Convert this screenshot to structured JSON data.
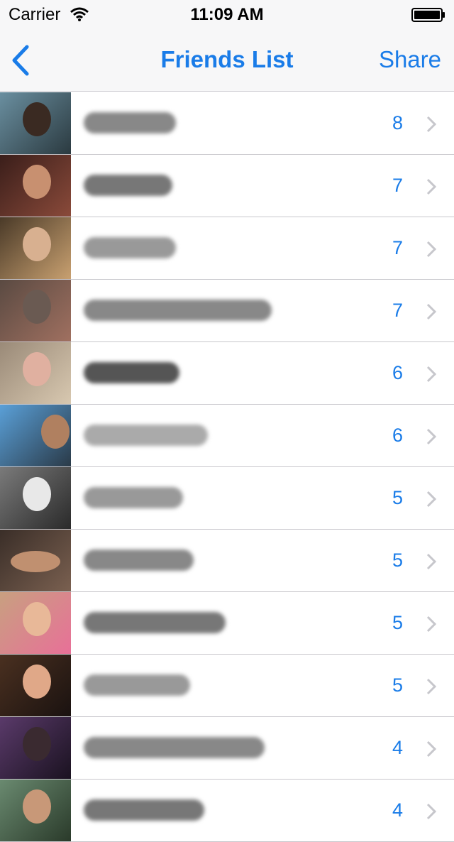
{
  "status_bar": {
    "carrier": "Carrier",
    "time": "11:09 AM"
  },
  "nav": {
    "title": "Friends List",
    "share_label": "Share",
    "accent_color": "#1a7ce8"
  },
  "friends": [
    {
      "count": "8"
    },
    {
      "count": "7"
    },
    {
      "count": "7"
    },
    {
      "count": "7"
    },
    {
      "count": "6"
    },
    {
      "count": "6"
    },
    {
      "count": "5"
    },
    {
      "count": "5"
    },
    {
      "count": "5"
    },
    {
      "count": "5"
    },
    {
      "count": "4"
    },
    {
      "count": "4"
    }
  ]
}
